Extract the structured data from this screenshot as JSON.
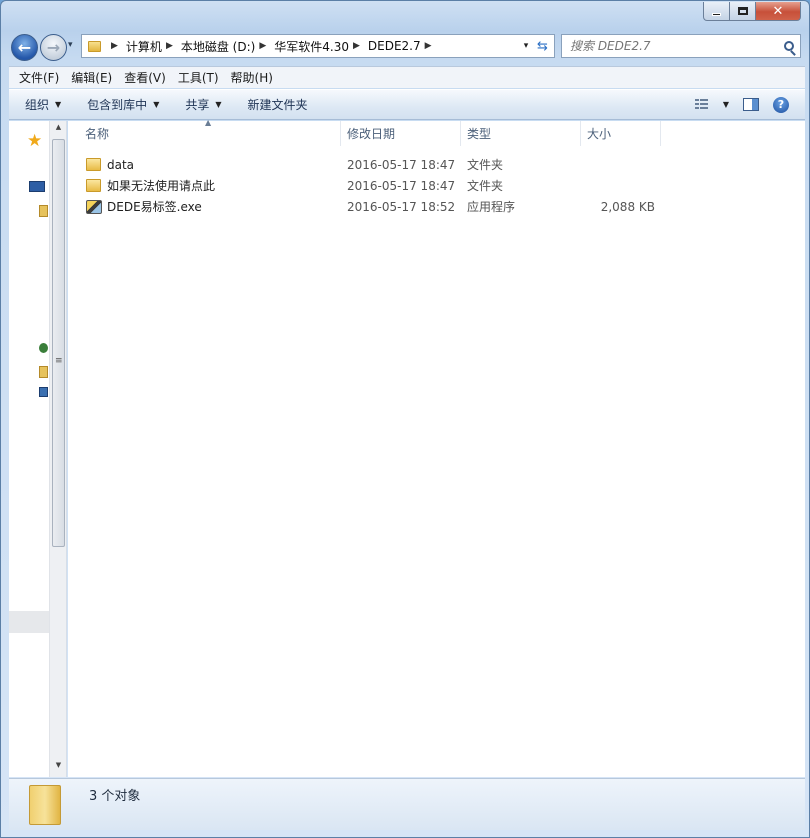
{
  "window": {
    "caption": {
      "minimize": "",
      "maximize": "",
      "close": "✕"
    }
  },
  "nav": {
    "back": "←",
    "forward": "→",
    "dropdown": "▾"
  },
  "address": {
    "breadcrumbs": [
      "计算机",
      "本地磁盘 (D:)",
      "华军软件4.30",
      "DEDE2.7"
    ],
    "separator": "▶"
  },
  "search": {
    "placeholder": "搜索 DEDE2.7"
  },
  "menubar": {
    "items": [
      "文件(F)",
      "编辑(E)",
      "查看(V)",
      "工具(T)",
      "帮助(H)"
    ]
  },
  "commandbar": {
    "organize": "组织",
    "include_library": "包含到库中",
    "share": "共享",
    "new_folder": "新建文件夹",
    "help": "?"
  },
  "columns": {
    "name": "名称",
    "date": "修改日期",
    "type": "类型",
    "size": "大小"
  },
  "files": [
    {
      "name": "data",
      "date": "2016-05-17 18:47",
      "type": "文件夹",
      "size": "",
      "icon": "folder-icon"
    },
    {
      "name": "如果无法使用请点此",
      "date": "2016-05-17 18:47",
      "type": "文件夹",
      "size": "",
      "icon": "folder-icon"
    },
    {
      "name": "DEDE易标签.exe",
      "date": "2016-05-17 18:52",
      "type": "应用程序",
      "size": "2,088 KB",
      "icon": "exe-icon"
    }
  ],
  "status": {
    "count": "3 个对象"
  },
  "colors": {
    "accent": "#2457a9",
    "close": "#c7503a",
    "folder": "#e8bb46"
  }
}
